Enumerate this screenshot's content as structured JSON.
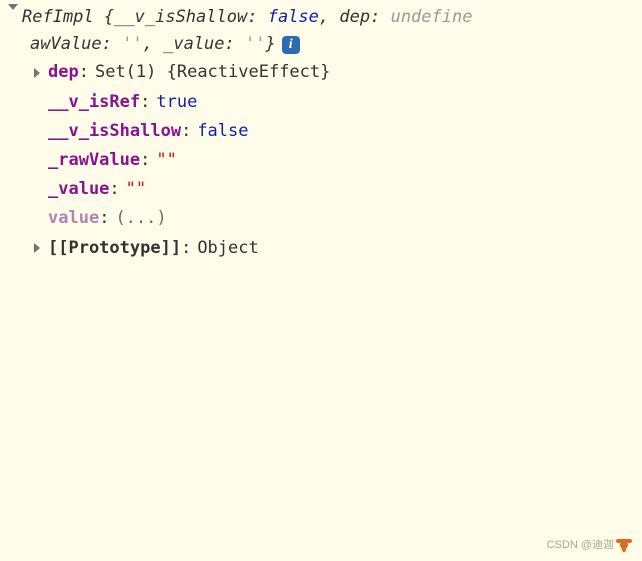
{
  "summary": {
    "className": "RefImpl",
    "openBrace": "{",
    "k1": "__v_isShallow",
    "v1": "false",
    "k2": "dep",
    "v2": "undefine",
    "line2pre": "awValue:",
    "v3": "''",
    "k4": "_value",
    "v4": "''",
    "closeBrace": "}"
  },
  "info": "i",
  "props": {
    "dep": {
      "key": "dep",
      "val": "Set(1) {ReactiveEffect}"
    },
    "isRef": {
      "key": "__v_isRef",
      "val": "true"
    },
    "isShallow": {
      "key": "__v_isShallow",
      "val": "false"
    },
    "rawValue": {
      "key": "_rawValue",
      "val": "\"\""
    },
    "value": {
      "key": "_value",
      "val": "\"\""
    },
    "getterValue": {
      "key": "value",
      "val": "(...)"
    },
    "proto": {
      "key": "[[Prototype]]",
      "val": "Object"
    }
  },
  "watermark": "CSDN @迪迦"
}
